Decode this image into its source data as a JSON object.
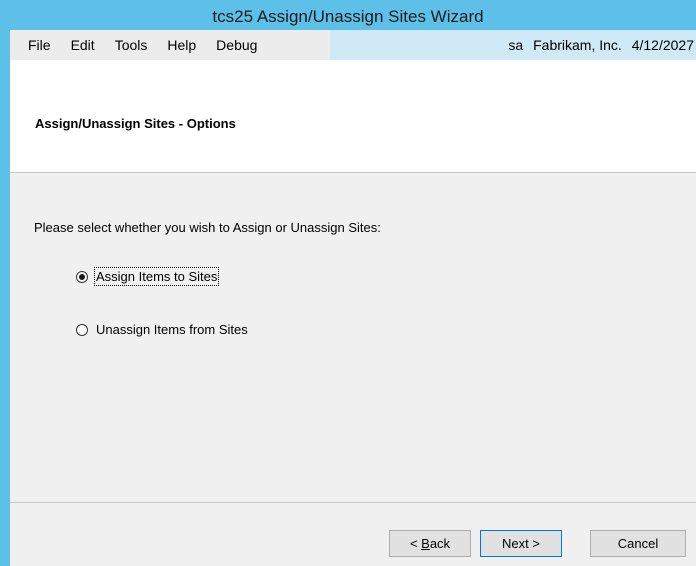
{
  "window": {
    "title": "tcs25 Assign/Unassign Sites Wizard"
  },
  "menubar": {
    "items": [
      "File",
      "Edit",
      "Tools",
      "Help",
      "Debug"
    ]
  },
  "status": {
    "user": "sa",
    "company": "Fabrikam, Inc.",
    "date": "4/12/2027"
  },
  "header": {
    "title": "Assign/Unassign Sites - Options"
  },
  "form": {
    "prompt": "Please select whether you wish to Assign or Unassign Sites:",
    "options": [
      {
        "label": "Assign Items to Sites",
        "selected": true
      },
      {
        "label": "Unassign Items from Sites",
        "selected": false
      }
    ]
  },
  "buttons": {
    "back_prefix": "< ",
    "back_accel": "B",
    "back_rest": "ack",
    "next": "Next >",
    "cancel": "Cancel"
  },
  "colors": {
    "titlebar": "#5cc0e8",
    "status_strip": "#cfe9f6",
    "content_bg": "#f0f0f0"
  }
}
